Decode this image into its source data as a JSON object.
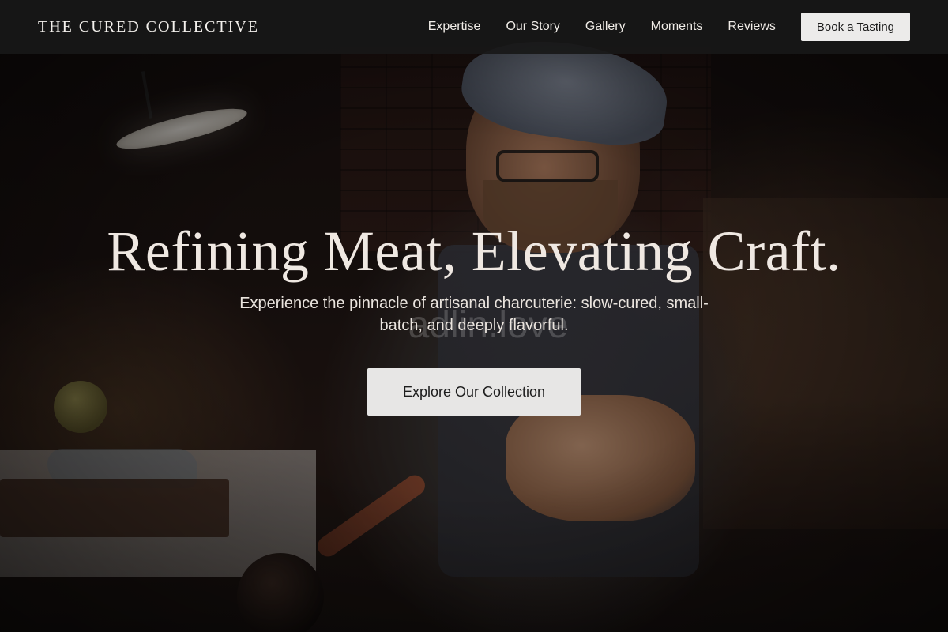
{
  "nav": {
    "brand": "THE CURED COLLECTIVE",
    "links": [
      {
        "label": "Expertise"
      },
      {
        "label": "Our Story"
      },
      {
        "label": "Gallery"
      },
      {
        "label": "Moments"
      },
      {
        "label": "Reviews"
      }
    ],
    "cta_label": "Book a Tasting"
  },
  "hero": {
    "title": "Refining Meat, Elevating Craft.",
    "subtitle": "Experience the pinnacle of artisanal charcuterie: slow-cured, small-batch, and deeply flavorful.",
    "cta_label": "Explore Our Collection",
    "watermark": "adlin.love"
  },
  "colors": {
    "nav_background": "#181818",
    "button_background": "#ecebea",
    "heading_text": "#efe8e2"
  }
}
